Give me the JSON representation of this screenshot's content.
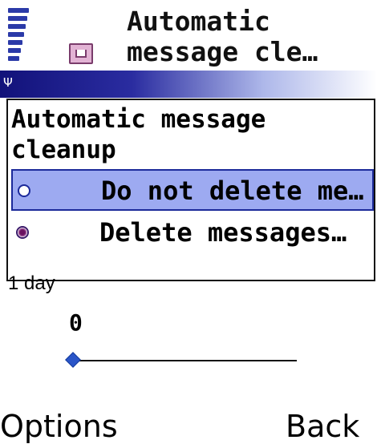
{
  "header": {
    "title_line1": "Automatic",
    "title_line2": "message cle…",
    "icons": [
      "signal-strength-icon",
      "message-settings-icon",
      "antenna-icon"
    ]
  },
  "setting": {
    "title_line1": "Automatic message",
    "title_line2": "cleanup",
    "options": [
      {
        "label": "Do not delete me…",
        "selected": true
      },
      {
        "label": "Delete messages…",
        "selected": false
      }
    ]
  },
  "slider": {
    "range_label": "1 day",
    "value": "0",
    "level": 0
  },
  "softkeys": {
    "left": "Options",
    "right": "Back"
  },
  "colors": {
    "accent": "#1c2a9a",
    "highlight": "#9daaf1",
    "title_bar_start": "#12127a"
  }
}
